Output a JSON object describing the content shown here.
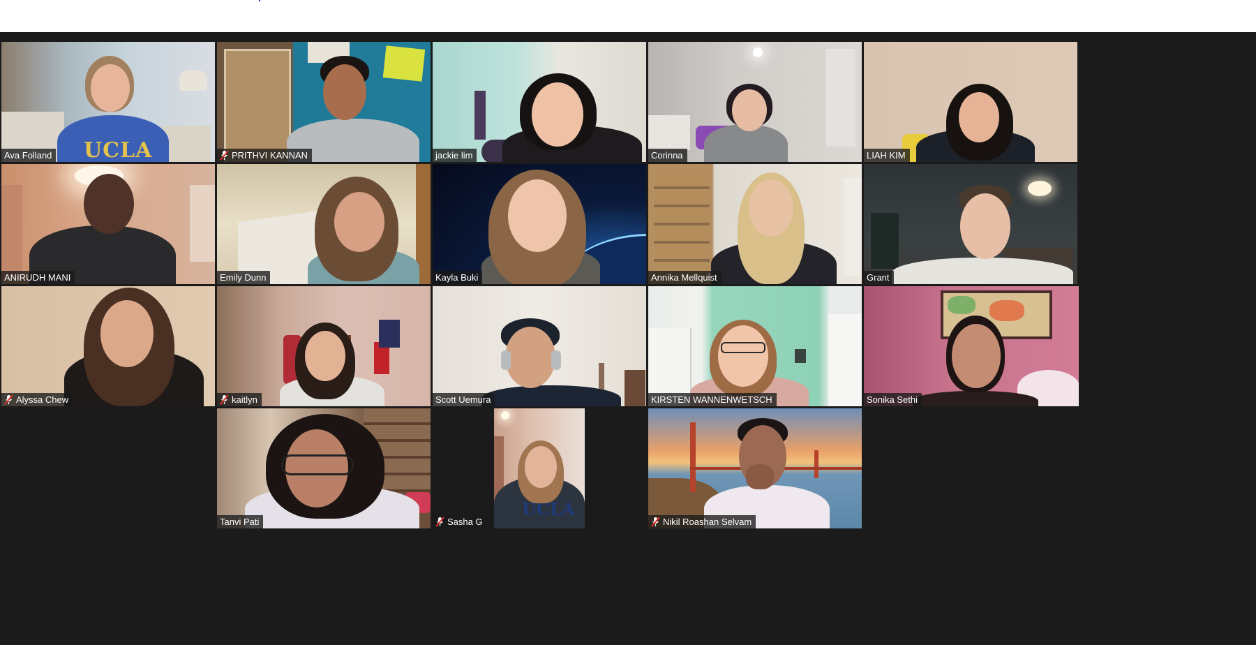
{
  "meeting": {
    "participants": [
      {
        "name": "Ava Folland",
        "muted": false
      },
      {
        "name": "PRITHVI KANNAN",
        "muted": true
      },
      {
        "name": "jackie lim",
        "muted": false
      },
      {
        "name": "Corinna",
        "muted": false
      },
      {
        "name": "LIAH KIM",
        "muted": false
      },
      {
        "name": "ANIRUDH MANI",
        "muted": false
      },
      {
        "name": "Emily Dunn",
        "muted": false
      },
      {
        "name": "Kayla Buki",
        "muted": false
      },
      {
        "name": "Annika Mellquist",
        "muted": false
      },
      {
        "name": "Grant",
        "muted": false
      },
      {
        "name": "Alyssa Chew",
        "muted": true
      },
      {
        "name": "kaitlyn",
        "muted": true
      },
      {
        "name": "Scott Uemura",
        "muted": false
      },
      {
        "name": "KIRSTEN WANNENWETSCH",
        "muted": false
      },
      {
        "name": "Sonika Sethi",
        "muted": false,
        "active_speaker": true
      },
      {
        "name": "Tanvi Pati",
        "muted": false
      },
      {
        "name": "Sasha G",
        "muted": true
      },
      {
        "name": "Nikil Roashan Selvam",
        "muted": true
      }
    ],
    "icons": {
      "muted": "muted-mic-icon"
    },
    "colors": {
      "stage_background": "#1b1b1b",
      "active_speaker_border": "#f2df55",
      "muted_icon": "#e0302b",
      "nametag_text": "#ffffff"
    },
    "sweatshirt_text": {
      "ava": "UCLA",
      "sasha": "UCLA"
    }
  }
}
